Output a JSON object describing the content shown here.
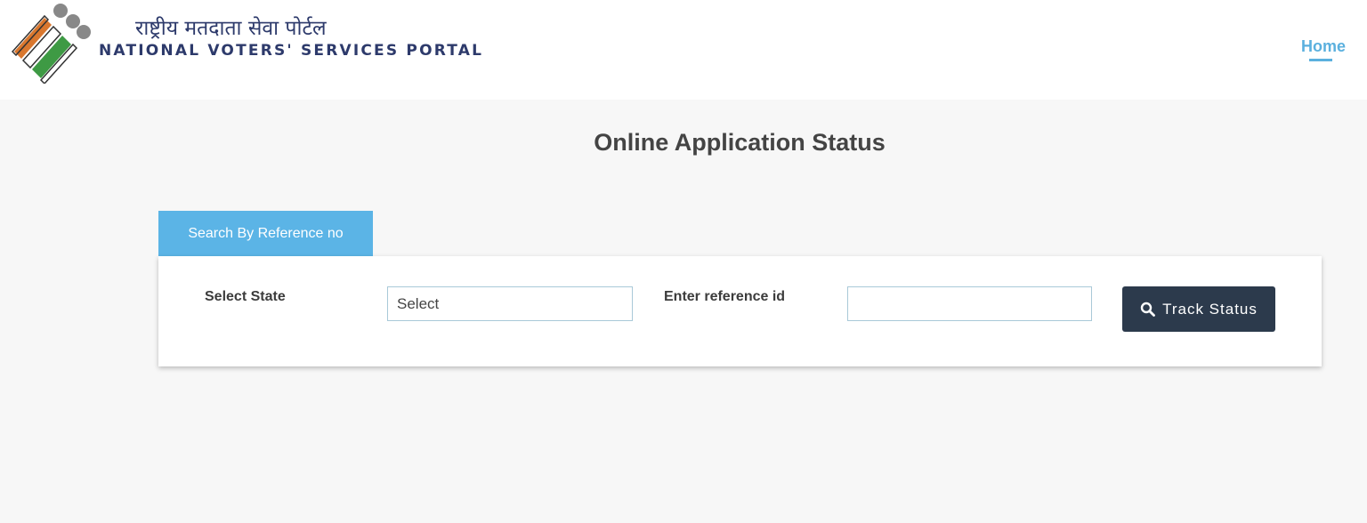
{
  "header": {
    "title_hindi": "राष्ट्रीय मतदाता सेवा पोर्टल",
    "title_english": "NATIONAL VOTERS' SERVICES PORTAL",
    "emblem_icon": "ballot-hands-emblem-icon",
    "nav": {
      "home_label": "Home"
    }
  },
  "page": {
    "title": "Online Application Status"
  },
  "tabs": [
    {
      "label": "Search By Reference no",
      "active": true
    }
  ],
  "form": {
    "state_label": "Select State",
    "state_value": "Select",
    "reference_label": "Enter reference id",
    "reference_value": "",
    "submit_label": "Track Status",
    "submit_icon": "search-icon"
  },
  "colors": {
    "accent": "#5bb0de",
    "tab_background": "#5bb4e6",
    "button_background": "#2c3a4c",
    "brand_text": "#2d3a6b",
    "emblem_orange": "#d9772e",
    "emblem_green": "#3e9a44",
    "emblem_grey": "#888888"
  }
}
